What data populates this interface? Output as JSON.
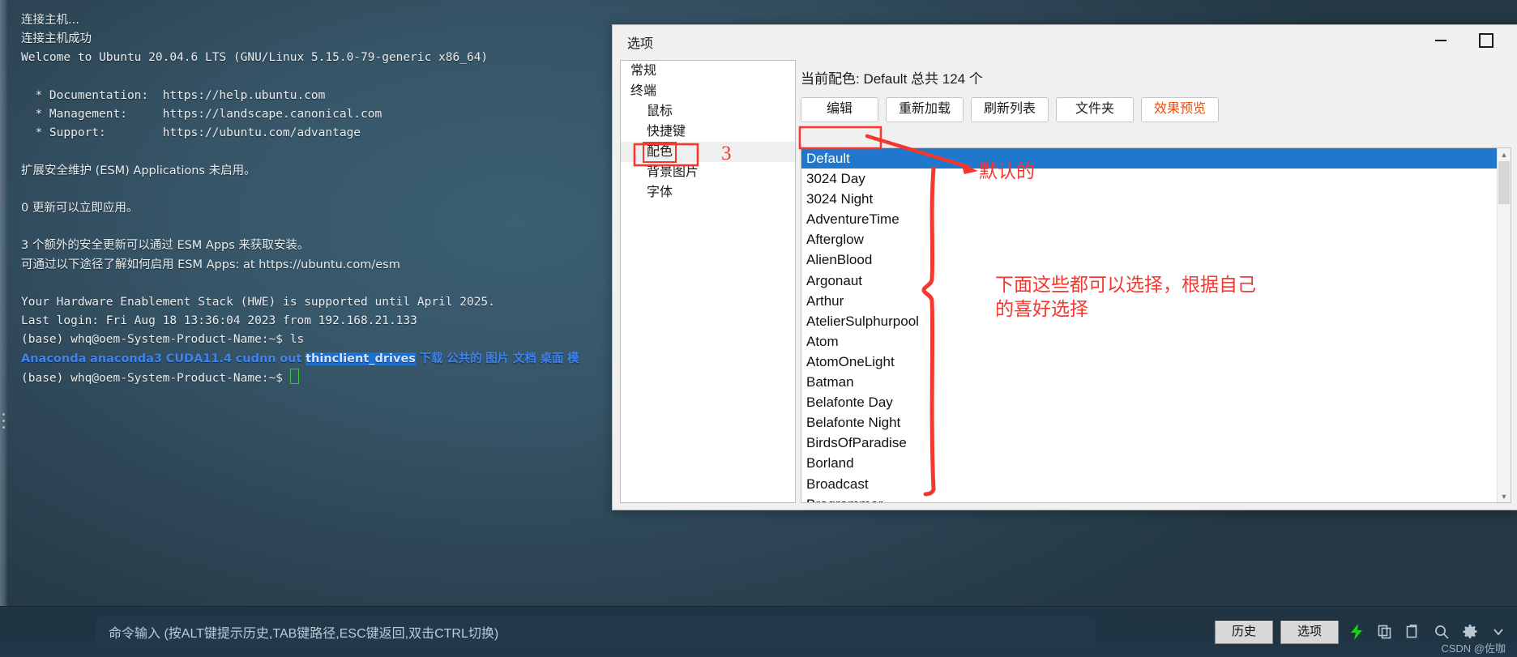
{
  "terminal": {
    "lines": [
      {
        "type": "cjk",
        "text": "连接主机..."
      },
      {
        "type": "cjk",
        "text": "连接主机成功"
      },
      {
        "type": "mono",
        "text": "Welcome to Ubuntu 20.04.6 LTS (GNU/Linux 5.15.0-79-generic x86_64)"
      },
      {
        "type": "blank",
        "text": ""
      },
      {
        "type": "mono",
        "text": "  * Documentation:  https://help.ubuntu.com"
      },
      {
        "type": "mono",
        "text": "  * Management:     https://landscape.canonical.com"
      },
      {
        "type": "mono",
        "text": "  * Support:        https://ubuntu.com/advantage"
      },
      {
        "type": "blank",
        "text": ""
      },
      {
        "type": "cjk",
        "text": "扩展安全维护 (ESM) Applications 未启用。"
      },
      {
        "type": "blank",
        "text": ""
      },
      {
        "type": "cjk",
        "text": "0 更新可以立即应用。"
      },
      {
        "type": "blank",
        "text": ""
      },
      {
        "type": "cjk",
        "text": "3 个额外的安全更新可以通过 ESM Apps 来获取安装。"
      },
      {
        "type": "cjk",
        "text": "可通过以下途径了解如何启用 ESM Apps: at https://ubuntu.com/esm"
      },
      {
        "type": "blank",
        "text": ""
      },
      {
        "type": "mono",
        "text": "Your Hardware Enablement Stack (HWE) is supported until April 2025."
      },
      {
        "type": "mono",
        "text": "Last login: Fri Aug 18 13:36:04 2023 from 192.168.21.133"
      },
      {
        "type": "mono",
        "text": "(base) whq@oem-System-Product-Name:~$ ls"
      }
    ],
    "ls_output": [
      {
        "name": "Anaconda",
        "style": "blue"
      },
      {
        "name": "anaconda3",
        "style": "blue"
      },
      {
        "name": "CUDA11.4",
        "style": "blue"
      },
      {
        "name": "cudnn",
        "style": "blue"
      },
      {
        "name": "out",
        "style": "blue"
      },
      {
        "name": "thinclient_drives",
        "style": "selected"
      },
      {
        "name": "下载",
        "style": "blue"
      },
      {
        "name": "公共的",
        "style": "blue"
      },
      {
        "name": "图片",
        "style": "blue"
      },
      {
        "name": "文档",
        "style": "blue"
      },
      {
        "name": "桌面",
        "style": "blue"
      },
      {
        "name": "模",
        "style": "blue"
      }
    ],
    "prompt_last": "(base) whq@oem-System-Product-Name:~$ "
  },
  "bottom_bar": {
    "command_placeholder": "命令输入 (按ALT键提示历史,TAB键路径,ESC键返回,双击CTRL切换)",
    "history_label": "历史",
    "options_label": "选项",
    "watermark": "CSDN @佐咖",
    "icons": [
      "lightning-icon",
      "copy-icon",
      "paste-icon",
      "search-icon",
      "gear-icon",
      "chevron-down-icon"
    ]
  },
  "dialog": {
    "title": "选项",
    "minimize_label": "—",
    "maximize_label": "□",
    "nav": [
      {
        "label": "常规",
        "level": 1,
        "selected": false
      },
      {
        "label": "终端",
        "level": 1,
        "selected": false
      },
      {
        "label": "鼠标",
        "level": 2,
        "selected": false
      },
      {
        "label": "快捷键",
        "level": 2,
        "selected": false
      },
      {
        "label": "配色",
        "level": 2,
        "selected": true
      },
      {
        "label": "背景图片",
        "level": 2,
        "selected": false
      },
      {
        "label": "字体",
        "level": 2,
        "selected": false
      }
    ],
    "scheme_header": "当前配色: Default 总共 124 个",
    "buttons": [
      {
        "label": "编辑",
        "accent": false
      },
      {
        "label": "重新加载",
        "accent": false
      },
      {
        "label": "刷新列表",
        "accent": false
      },
      {
        "label": "文件夹",
        "accent": false
      },
      {
        "label": "效果预览",
        "accent": true
      }
    ],
    "schemes": [
      {
        "name": "Default",
        "selected": true
      },
      {
        "name": "3024 Day",
        "selected": false
      },
      {
        "name": "3024 Night",
        "selected": false
      },
      {
        "name": "AdventureTime",
        "selected": false
      },
      {
        "name": "Afterglow",
        "selected": false
      },
      {
        "name": "AlienBlood",
        "selected": false
      },
      {
        "name": "Argonaut",
        "selected": false
      },
      {
        "name": "Arthur",
        "selected": false
      },
      {
        "name": "AtelierSulphurpool",
        "selected": false
      },
      {
        "name": "Atom",
        "selected": false
      },
      {
        "name": "AtomOneLight",
        "selected": false
      },
      {
        "name": "Batman",
        "selected": false
      },
      {
        "name": "Belafonte Day",
        "selected": false
      },
      {
        "name": "Belafonte Night",
        "selected": false
      },
      {
        "name": "BirdsOfParadise",
        "selected": false
      },
      {
        "name": "Borland",
        "selected": false
      },
      {
        "name": "Broadcast",
        "selected": false
      },
      {
        "name": "Brogrammer",
        "selected": false
      }
    ]
  },
  "annotations": {
    "step_number": "3",
    "default_note": "默认的",
    "list_note": "下面这些都可以选择，根据自己\n的喜好选择",
    "color": "#f3382f"
  }
}
